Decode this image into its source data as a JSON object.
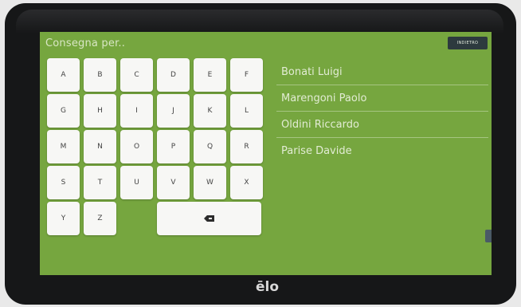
{
  "screen": {
    "title": "Consegna per..",
    "back_label": "INDIETRO"
  },
  "keyboard": {
    "letters": [
      "A",
      "B",
      "C",
      "D",
      "E",
      "F",
      "G",
      "H",
      "I",
      "J",
      "K",
      "L",
      "M",
      "N",
      "O",
      "P",
      "Q",
      "R",
      "S",
      "T",
      "U",
      "V",
      "W",
      "X",
      "Y",
      "Z"
    ],
    "backspace_icon": "backspace-icon"
  },
  "names": [
    "Bonati Luigi",
    "Marengoni Paolo",
    "Oldini Riccardo",
    "Parise Davide"
  ],
  "device": {
    "logo": "ēlo"
  },
  "colors": {
    "screen_bg": "#76a63f",
    "key_bg": "#f7f7f5",
    "button_dark": "#2d3a3e",
    "bezel": "#161718"
  }
}
